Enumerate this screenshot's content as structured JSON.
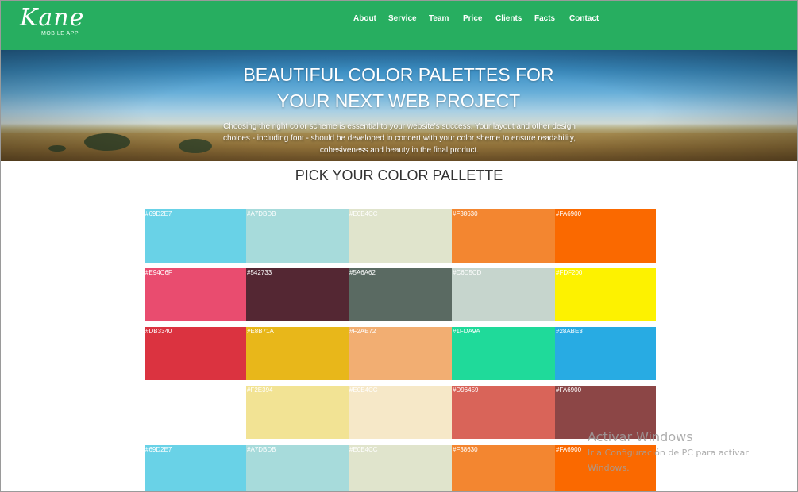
{
  "brand": {
    "name": "Kane",
    "tagline": "MOBILE APP"
  },
  "nav": {
    "items": [
      "About",
      "Service",
      "Team",
      "Price",
      "Clients",
      "Facts",
      "Contact"
    ]
  },
  "hero": {
    "title_line1": "BEAUTIFUL COLOR PALETTES FOR",
    "title_line2": "YOUR NEXT WEB PROJECT",
    "text": "Choosing the right color scheme is essential to your website's success. Your layout and other design choices - including font - should be developed in concert with your color sheme to ensure readability, cohesiveness and beauty in the final product."
  },
  "section": {
    "title": "PICK YOUR COLOR PALLETTE"
  },
  "palettes": [
    [
      {
        "label": "#69D2E7",
        "color": "#69D2E7"
      },
      {
        "label": "#A7DBDB",
        "color": "#A7DBDB"
      },
      {
        "label": "#E0E4CC",
        "color": "#E0E4CC"
      },
      {
        "label": "#F38630",
        "color": "#F38630"
      },
      {
        "label": "#FA6900",
        "color": "#FA6900"
      }
    ],
    [
      {
        "label": "#E94C6F",
        "color": "#E94C6F"
      },
      {
        "label": "#542733",
        "color": "#542733"
      },
      {
        "label": "#5A6A62",
        "color": "#5A6A62"
      },
      {
        "label": "#C6D5CD",
        "color": "#C6D5CD"
      },
      {
        "label": "#FDF200",
        "color": "#FDF200"
      }
    ],
    [
      {
        "label": "#DB3340",
        "color": "#DB3340"
      },
      {
        "label": "#E8B71A",
        "color": "#E8B71A"
      },
      {
        "label": "#F2AE72",
        "color": "#F2AE72"
      },
      {
        "label": "#1FDA9A",
        "color": "#1FDA9A"
      },
      {
        "label": "#28ABE3",
        "color": "#28ABE3"
      }
    ],
    [
      {
        "label": "",
        "color": "#FFFFFF"
      },
      {
        "label": "#F2E394",
        "color": "#F2E394"
      },
      {
        "label": "#E0E4CC",
        "color": "#F6E8C8"
      },
      {
        "label": "#D96459",
        "color": "#D96459"
      },
      {
        "label": "#FA6900",
        "color": "#8C4646"
      }
    ],
    [
      {
        "label": "#69D2E7",
        "color": "#69D2E7"
      },
      {
        "label": "#A7DBDB",
        "color": "#A7DBDB"
      },
      {
        "label": "#E0E4CC",
        "color": "#E0E4CC"
      },
      {
        "label": "#F38630",
        "color": "#F38630"
      },
      {
        "label": "#FA6900",
        "color": "#FA6900"
      }
    ]
  ],
  "watermark": {
    "title": "Activar Windows",
    "subtitle": "Ir a Configuración de PC para activar Windows."
  },
  "colors": {
    "navbar": "#27AE60",
    "section_text": "#333333"
  }
}
